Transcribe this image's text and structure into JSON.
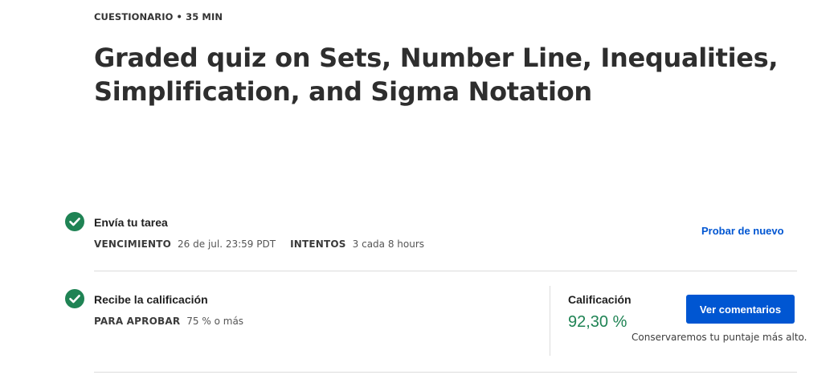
{
  "header": {
    "eyebrow": "CUESTIONARIO • 35 MIN",
    "title": "Graded quiz on Sets, Number Line, Inequalities, Simplification, and Sigma Notation"
  },
  "steps": [
    {
      "status_icon": "check-circle-icon",
      "title": "Envía tu tarea",
      "meta": [
        {
          "key": "VENCIMIENTO",
          "value": "26 de jul. 23:59 PDT"
        },
        {
          "key": "INTENTOS",
          "value": "3 cada 8 hours"
        }
      ],
      "action_label": "Probar de nuevo"
    },
    {
      "status_icon": "check-circle-icon",
      "title": "Recibe la calificación",
      "meta": [
        {
          "key": "PARA APROBAR",
          "value": "75 % o más"
        }
      ],
      "grade": {
        "label": "Calificación",
        "value": "92,30 %",
        "button_label": "Ver comentarios",
        "note": "Conservaremos tu puntaje más alto."
      }
    }
  ],
  "colors": {
    "success": "#1f8354",
    "primary": "#0056d2",
    "divider": "#dcdcdc"
  }
}
